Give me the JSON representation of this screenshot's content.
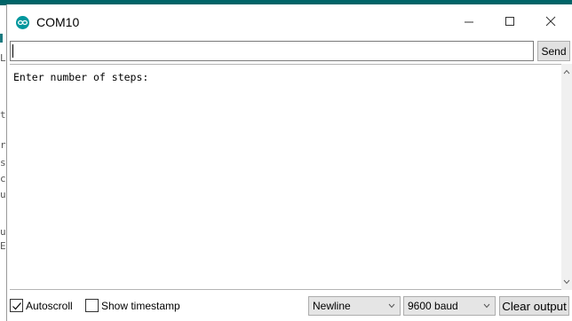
{
  "window": {
    "title": "COM10",
    "controls": {
      "minimize": "minimize-icon",
      "maximize": "maximize-icon",
      "close": "close-icon"
    }
  },
  "input": {
    "value": "",
    "send_label": "Send"
  },
  "output": {
    "lines": [
      "Enter number of steps:"
    ]
  },
  "footer": {
    "autoscroll": {
      "label": "Autoscroll",
      "checked": true
    },
    "show_timestamp": {
      "label": "Show timestamp",
      "checked": false
    },
    "line_ending": {
      "selected": "Newline"
    },
    "baud_rate": {
      "selected": "9600 baud"
    },
    "clear_label": "Clear output"
  },
  "background_ide": {
    "margin_glyphs": [
      "L",
      "t",
      "r",
      "s",
      "c",
      "u",
      "u",
      "E"
    ]
  },
  "colors": {
    "accent": "#00979d",
    "ide_bar": "#006468"
  }
}
